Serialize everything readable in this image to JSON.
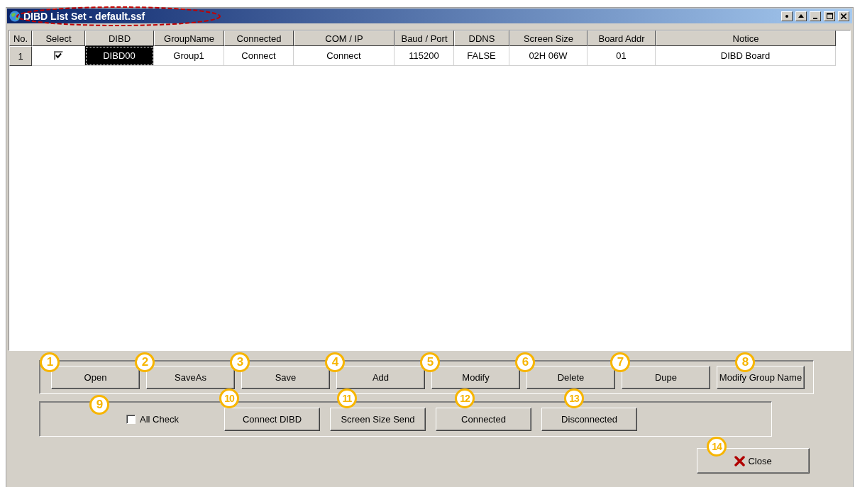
{
  "window": {
    "title": "DIBD List Set - default.ssf",
    "title_highlighted": true
  },
  "table": {
    "columns": [
      "No.",
      "Select",
      "DIBD",
      "GroupName",
      "Connected",
      "COM / IP",
      "Baud / Port",
      "DDNS",
      "Screen Size",
      "Board Addr",
      "Notice"
    ],
    "rows": [
      {
        "cells": [
          {
            "kind": "number",
            "text": "1",
            "selected": false
          },
          {
            "kind": "checkbox",
            "checked": true,
            "selected": false
          },
          {
            "text": "DIBD00",
            "selected": true
          },
          {
            "text": "Group1",
            "selected": false
          },
          {
            "text": "Connect",
            "selected": false
          },
          {
            "text": "Connect",
            "selected": false
          },
          {
            "text": "115200",
            "selected": false
          },
          {
            "text": "FALSE",
            "selected": false
          },
          {
            "text": "02H 06W",
            "selected": false
          },
          {
            "text": "01",
            "selected": false
          },
          {
            "text": "DIBD Board",
            "selected": false
          }
        ]
      }
    ]
  },
  "file_buttons": [
    {
      "label": "Open",
      "callout": "1"
    },
    {
      "label": "SaveAs",
      "callout": "2"
    },
    {
      "label": "Save",
      "callout": "3"
    },
    {
      "label": "Add",
      "callout": "4"
    },
    {
      "label": "Modify",
      "callout": "5"
    },
    {
      "label": "Delete",
      "callout": "6"
    },
    {
      "label": "Dupe",
      "callout": "7"
    },
    {
      "label": "Modify Group Name",
      "callout": "8"
    }
  ],
  "all_check": {
    "label": "All Check",
    "checked": false,
    "callout": "9"
  },
  "connect_buttons": [
    {
      "label": "Connect DIBD",
      "callout": "10"
    },
    {
      "label": "Screen Size Send",
      "callout": "11"
    },
    {
      "label": "Connected",
      "callout": "12"
    },
    {
      "label": "Disconnected",
      "callout": "13"
    }
  ],
  "close_button": {
    "label": "Close",
    "callout": "14"
  }
}
